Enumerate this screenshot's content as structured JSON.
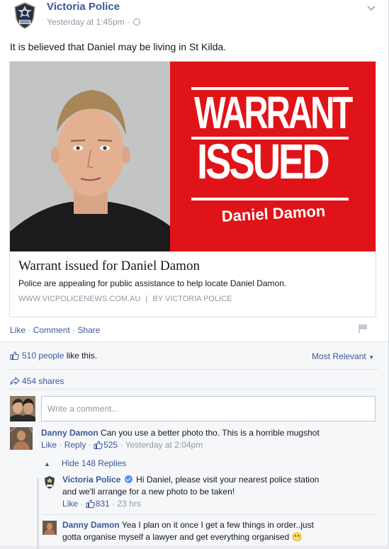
{
  "post": {
    "page_name": "Victoria Police",
    "timestamp": "Yesterday at 1:45pm",
    "meta_sep": "·",
    "text": "It is believed that Daniel may be living in St Kilda."
  },
  "preview": {
    "banner_line1": "WARRANT",
    "banner_line2": "ISSUED",
    "banner_name": "Daniel Damon",
    "title": "Warrant issued for Daniel Damon",
    "description": "Police are appealing for public assistance to help locate Daniel Damon.",
    "source": "WWW.VICPOLICENEWS.COM.AU",
    "byline": "BY VICTORIA POLICE",
    "source_sep": "|"
  },
  "actions": {
    "like": "Like",
    "comment": "Comment",
    "share": "Share",
    "sep": "·"
  },
  "ufi": {
    "likes_count": "510 people",
    "likes_suffix": "like this.",
    "sort_label": "Most Relevant",
    "shares": "454 shares",
    "comment_placeholder": "Write a comment..."
  },
  "comments": [
    {
      "name": "Danny Damon",
      "text": "Can you use a better photo tho. This is a horrible mugshot",
      "like": "Like",
      "reply": "Reply",
      "likes": "525",
      "time": "Yesterday at 2:04pm"
    }
  ],
  "hide_replies": "Hide 148 Replies",
  "replies": [
    {
      "name": "Victoria Police",
      "text_line1": "Hi Daniel, please visit your nearest police station",
      "text_line2": "and we'll arrange for a new photo to be taken!",
      "like": "Like",
      "likes": "831",
      "time": "23 hrs"
    },
    {
      "name": "Danny Damon",
      "text_line1": "Yea I plan on it once I get a few things in order..just",
      "text_line2": "gotta organise myself a lawyer and get everything organised",
      "emoji": "😁"
    }
  ],
  "colors": {
    "link": "#3b5998",
    "banner_red": "#e01418",
    "meta_grey": "#9197a3"
  },
  "icons": [
    "police-badge-icon",
    "globe-icon",
    "chevron-down-icon",
    "thumbs-up-icon",
    "share-arrow-icon",
    "flag-icon",
    "verified-icon",
    "caret-up-icon"
  ]
}
